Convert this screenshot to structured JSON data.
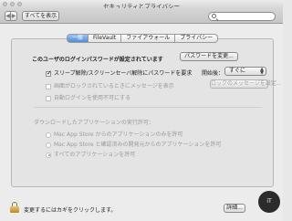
{
  "window": {
    "title": "セキュリティとプライバシー"
  },
  "toolbar": {
    "back": "◀",
    "forward": "▶",
    "show_all": "すべてを表示",
    "search_placeholder": ""
  },
  "tabs": [
    {
      "label": "一般",
      "active": true
    },
    {
      "label": "FileVault",
      "active": false
    },
    {
      "label": "ファイアウォール",
      "active": false
    },
    {
      "label": "プライバシー",
      "active": false
    }
  ],
  "general": {
    "password_set_text": "このユーザのログインパスワードが設定されています",
    "change_password_button": "パスワードを変更...",
    "require_password": {
      "label": "スリープ解除/スクリーンセーバ解除にパスワードを要求",
      "checked": true
    },
    "start_label": "開始後：",
    "start_value": "すぐに",
    "lock_message": {
      "label": "画面がロックされているときにメッセージを表示",
      "checked": false,
      "enabled": false
    },
    "set_lock_message_button": "ロックのメッセージを設定...",
    "disable_auto_login": {
      "label": "自動ログインを使用不可にする",
      "checked": false,
      "enabled": false
    },
    "download_section_title": "ダウンロードしたアプリケーションの実行許可：",
    "download_options": [
      {
        "label": "Mac App Store からのアプリケーションのみを許可",
        "selected": false
      },
      {
        "label": "Mac App Store と確認済みの開発元からのアプリケーションを許可",
        "selected": false
      },
      {
        "label": "すべてのアプリケーションを許可",
        "selected": true
      }
    ]
  },
  "bottom": {
    "lock_text": "変更するにはカギをクリックします。",
    "advanced_button": "詳細...",
    "help_button": "?"
  },
  "watermark": {
    "text": "iT"
  }
}
